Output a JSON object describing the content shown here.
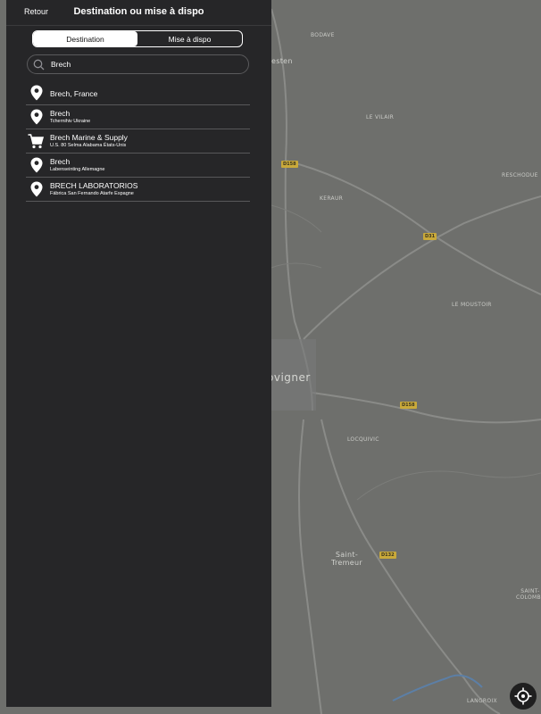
{
  "header": {
    "back_label": "Retour",
    "title": "Destination ou mise à dispo"
  },
  "segment": {
    "tabs": [
      {
        "label": "Destination",
        "active": true
      },
      {
        "label": "Mise à dispo",
        "active": false
      }
    ]
  },
  "search": {
    "value": "Brech",
    "icon": "search-icon"
  },
  "results": [
    {
      "name": "Brech, France",
      "subtitle": "",
      "icon": "location-pin-icon"
    },
    {
      "name": "Brech",
      "subtitle": "Tchernihiv Ukraine",
      "icon": "location-pin-icon"
    },
    {
      "name": "Brech Marine & Supply",
      "subtitle": "U.S. 80 Selma Alabama États-Unis",
      "icon": "shopping-cart-icon"
    },
    {
      "name": "Brech",
      "subtitle": "Labenseinting Allemagne",
      "icon": "location-pin-icon"
    },
    {
      "name": "BRECH LABORATORIOS",
      "subtitle": "Fábrica San Fernando Atarfe Espagne",
      "icon": "location-pin-icon"
    }
  ],
  "map": {
    "places": {
      "bodave": "BODAVE",
      "esten": "esten",
      "le_vilair": "LE VILAIR",
      "keraur": "KERAUR",
      "reschodue": "RESCHODUE",
      "le_moustoir": "LE MOUSTOIR",
      "town": "ovigner",
      "locquivic": "LOCQUIVIC",
      "saint_tremeur": "Saint-\nTremeur",
      "saint_colombe": "SAINT-\nCOLOMBE",
      "langroix": "LANGROIX"
    },
    "roads": {
      "r1": "D158",
      "r2": "D31",
      "r3": "D158",
      "r4": "D132"
    }
  },
  "colors": {
    "panel": "#262628",
    "map": "#6e6f6c",
    "accent": "#ffffff"
  }
}
